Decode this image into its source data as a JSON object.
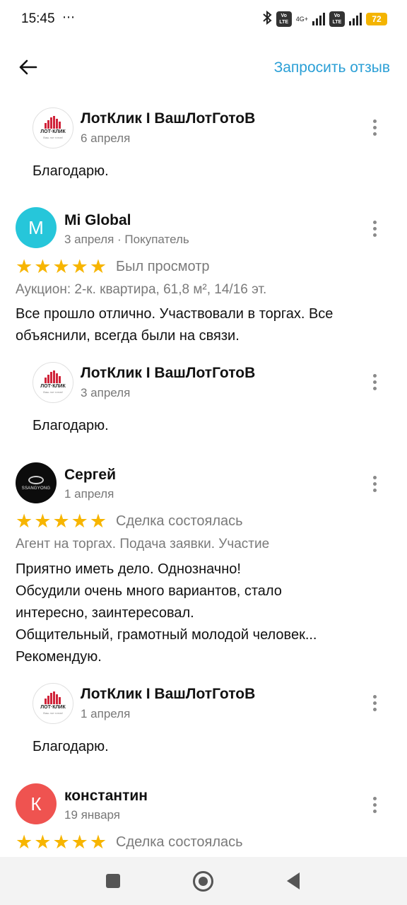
{
  "status_bar": {
    "time": "15:45",
    "extra": "⋯",
    "battery": "72",
    "network": "4G+",
    "volte_label": "Vo LTE"
  },
  "header": {
    "back_icon": "arrow-left-icon",
    "request_review_label": "Запросить отзыв"
  },
  "reviews": [
    {
      "reply": {
        "author": "ЛотКлик I ВашЛотГотоВ",
        "date": "6 апреля",
        "text": "Благодарю.",
        "logo_text": "ЛОТ·КЛИК",
        "logo_sub": "Ваш лот готов!"
      }
    },
    {
      "author": "Mi Global",
      "avatar_letter": "M",
      "avatar_color": "#26c6da",
      "meta": "3 апреля · Покупатель",
      "rating": 5,
      "rating_label": "Был просмотр",
      "subline": "Аукцион: 2-к. квартира, 61,8 м², 14/16 эт.",
      "text_lines": [
        "Все прошло отлично. Участвовали в торгах. Все",
        "объяснили, всегда были на связи."
      ],
      "reply": {
        "author": "ЛотКлик I ВашЛотГотоВ",
        "date": "3 апреля",
        "text": "Благодарю.",
        "logo_text": "ЛОТ·КЛИК",
        "logo_sub": "Ваш лот готов!"
      }
    },
    {
      "author": "Сергей",
      "avatar_text": "SSANGYONG",
      "meta": "1 апреля",
      "rating": 5,
      "rating_label": "Сделка состоялась",
      "subline": "Агент на торгах. Подача заявки. Участие",
      "text_lines": [
        "Приятно иметь дело. Однозначно!",
        "Обсудили очень много вариантов, стало",
        "интересно, заинтересовал.",
        "Общительный, грамотный молодой человек...",
        "Рекомендую."
      ],
      "reply": {
        "author": "ЛотКлик I ВашЛотГотоВ",
        "date": "1 апреля",
        "text": "Благодарю.",
        "logo_text": "ЛОТ·КЛИК",
        "logo_sub": "Ваш лот готов!"
      }
    },
    {
      "author": "константин",
      "avatar_letter": "К",
      "avatar_color": "#ef5350",
      "meta": "19 января",
      "rating": 5,
      "rating_label": "Сделка состоялась"
    }
  ],
  "star_color": "#f7b500",
  "accent_color": "#2a9fd6",
  "star_glyph": "★",
  "nav": {
    "square_icon": "recent-apps-icon",
    "circle_icon": "home-icon",
    "triangle_icon": "back-triangle-icon"
  }
}
